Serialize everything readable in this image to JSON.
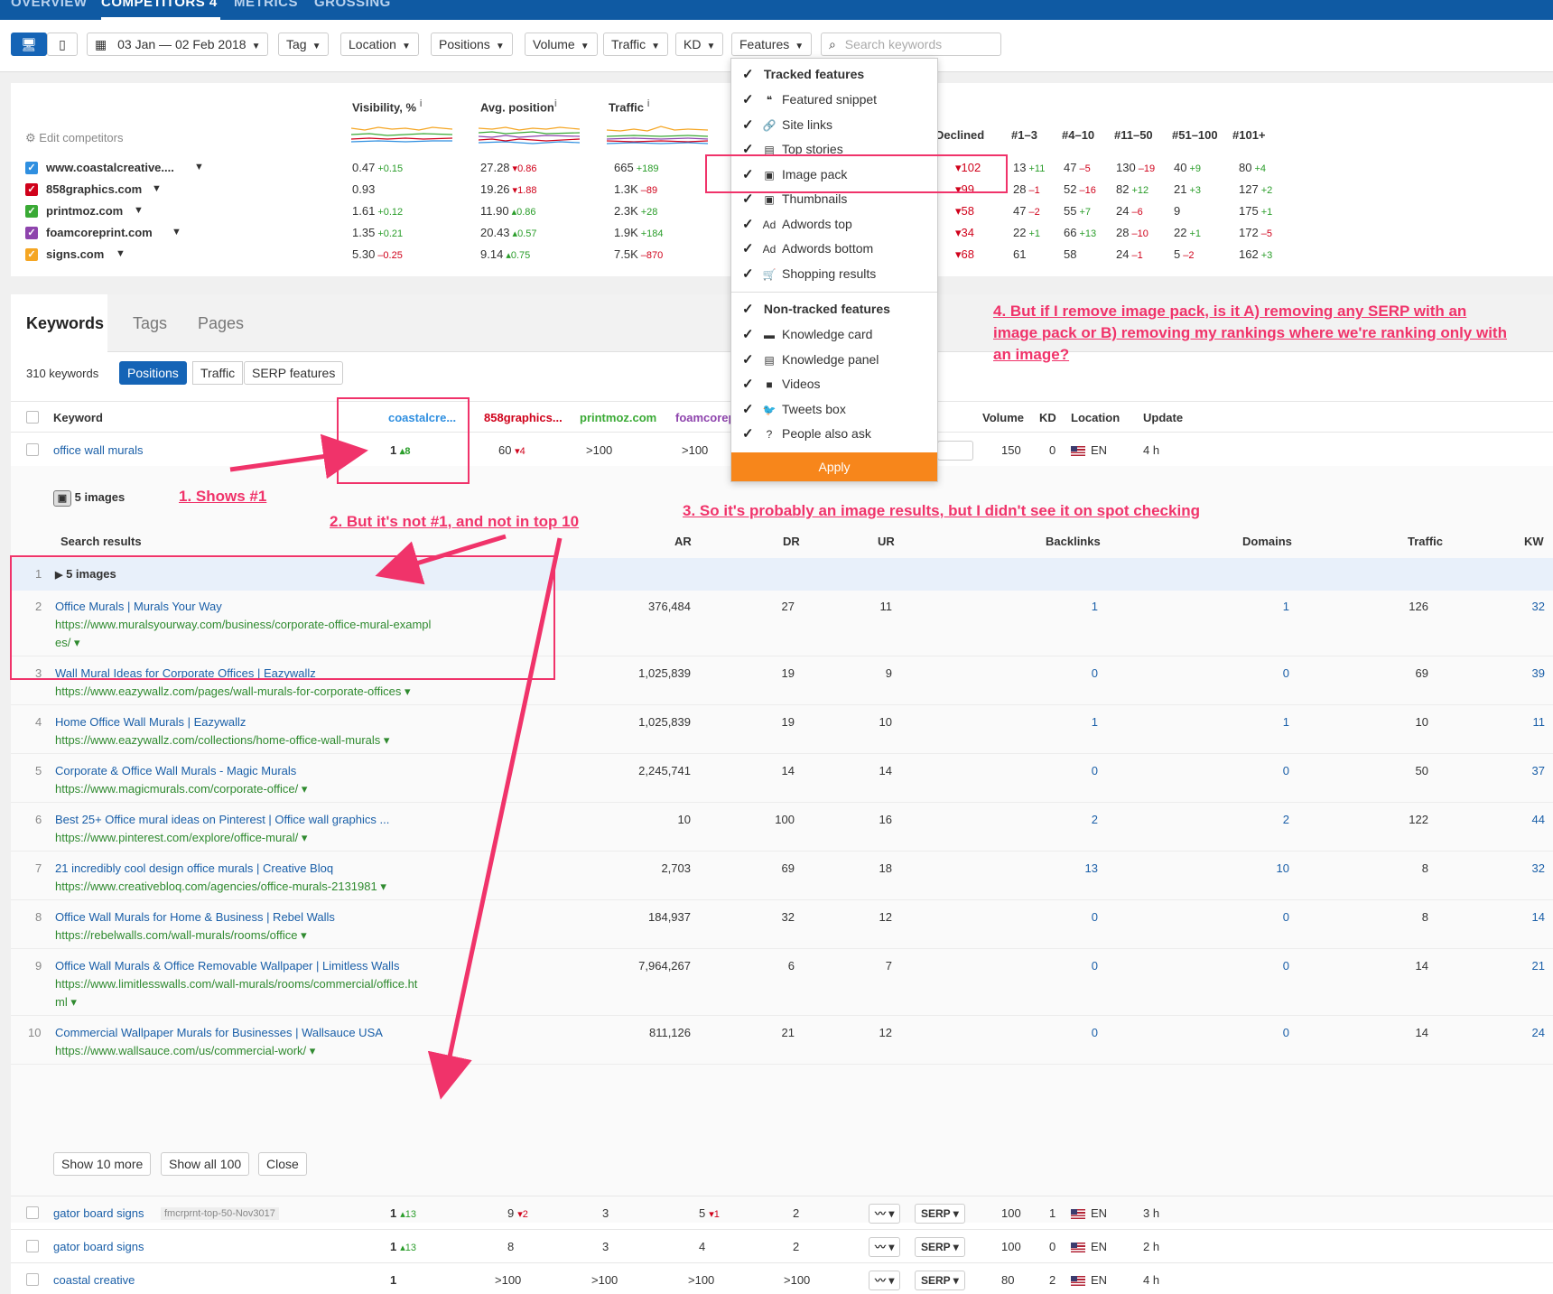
{
  "top_nav": {
    "tabs": [
      "OVERVIEW",
      "COMPETITORS 4",
      "METRICS",
      "GROSSING"
    ]
  },
  "toolbar": {
    "date_range": "03 Jan — 02 Feb 2018",
    "filters": [
      "Tag",
      "Location",
      "Positions",
      "Volume",
      "Traffic",
      "KD",
      "Features"
    ],
    "search_placeholder": "Search keywords"
  },
  "competitors": {
    "edit_label": "Edit competitors",
    "metric_headers": [
      "Visibility, %",
      "Avg. position",
      "Traffic"
    ],
    "rank_headers": [
      "Declined",
      "#1–3",
      "#4–10",
      "#11–50",
      "#51–100",
      "#101+"
    ],
    "rows": [
      {
        "name": "www.coastalcreative....",
        "color": "#2f8fe0",
        "vis": "0.47",
        "vis_d": "+0.15",
        "avg": "27.28",
        "avg_d": "▾0.86",
        "traffic": "665",
        "traffic_d": "+189",
        "declined": "▾102",
        "r1": "13",
        "r1d": "+11",
        "r2": "47",
        "r2d": "–5",
        "r3": "130",
        "r3d": "–19",
        "r4": "40",
        "r4d": "+9",
        "r5": "80",
        "r5d": "+4"
      },
      {
        "name": "858graphics.com",
        "color": "#d0021b",
        "vis": "0.93",
        "vis_d": "",
        "avg": "19.26",
        "avg_d": "▾1.88",
        "traffic": "1.3K",
        "traffic_d": "–89",
        "declined": "▾99",
        "r1": "28",
        "r1d": "–1",
        "r2": "52",
        "r2d": "–16",
        "r3": "82",
        "r3d": "+12",
        "r4": "21",
        "r4d": "+3",
        "r5": "127",
        "r5d": "+2"
      },
      {
        "name": "printmoz.com",
        "color": "#3aaa35",
        "vis": "1.61",
        "vis_d": "+0.12",
        "avg": "11.90",
        "avg_d": "▴0.86",
        "traffic": "2.3K",
        "traffic_d": "+28",
        "declined": "▾58",
        "r1": "47",
        "r1d": "–2",
        "r2": "55",
        "r2d": "+7",
        "r3": "24",
        "r3d": "–6",
        "r4": "9",
        "r4d": "",
        "r5": "175",
        "r5d": "+1"
      },
      {
        "name": "foamcoreprint.com",
        "color": "#8e44ad",
        "vis": "1.35",
        "vis_d": "+0.21",
        "avg": "20.43",
        "avg_d": "▴0.57",
        "traffic": "1.9K",
        "traffic_d": "+184",
        "declined": "▾34",
        "r1": "22",
        "r1d": "+1",
        "r2": "66",
        "r2d": "+13",
        "r3": "28",
        "r3d": "–10",
        "r4": "22",
        "r4d": "+1",
        "r5": "172",
        "r5d": "–5"
      },
      {
        "name": "signs.com",
        "color": "#f5a623",
        "vis": "5.30",
        "vis_d": "–0.25",
        "avg": "9.14",
        "avg_d": "▴0.75",
        "traffic": "7.5K",
        "traffic_d": "–870",
        "declined": "▾68",
        "r1": "61",
        "r1d": "",
        "r2": "58",
        "r2d": "",
        "r3": "24",
        "r3d": "–1",
        "r4": "5",
        "r4d": "–2",
        "r5": "162",
        "r5d": "+3"
      }
    ]
  },
  "keywords": {
    "tabs": [
      "Keywords",
      "Tags",
      "Pages"
    ],
    "count_label": "310 keywords",
    "view_buttons": [
      "Positions",
      "Traffic",
      "SERP features"
    ],
    "columns": [
      "Keyword",
      "coastalcre...",
      "858graphics...",
      "printmoz.com",
      "foamcorep",
      "Volume",
      "KD",
      "Location",
      "Update"
    ],
    "main_row": {
      "keyword": "office wall murals",
      "pos": "1",
      "pos_d": "▴8",
      "c2": "60",
      "c2_d": "▾4",
      "c3": ">100",
      "c4": ">100",
      "serp": "RP ▴",
      "volume": "150",
      "kd": "0",
      "loc": "EN",
      "update": "4 h"
    },
    "images_badge": "5 images"
  },
  "serp": {
    "headers": [
      "Search results",
      "AR",
      "DR",
      "UR",
      "Backlinks",
      "Domains",
      "Traffic",
      "KW"
    ],
    "image_row": {
      "n": "1",
      "label": "5 images"
    },
    "results": [
      {
        "n": "2",
        "title": "Office Murals | Murals Your Way",
        "url": "https://www.muralsyourway.com/business/corporate-office-mural-exampl",
        "url2": "es/ ▾",
        "ar": "376,484",
        "dr": "27",
        "ur": "11",
        "bl": "1",
        "dom": "1",
        "traffic": "126",
        "kw": "32"
      },
      {
        "n": "3",
        "title": "Wall Mural Ideas for Corporate Offices | Eazywallz",
        "url": "https://www.eazywallz.com/pages/wall-murals-for-corporate-offices ▾",
        "url2": "",
        "ar": "1,025,839",
        "dr": "19",
        "ur": "9",
        "bl": "0",
        "dom": "0",
        "traffic": "69",
        "kw": "39"
      },
      {
        "n": "4",
        "title": "Home Office Wall Murals | Eazywallz",
        "url": "https://www.eazywallz.com/collections/home-office-wall-murals ▾",
        "url2": "",
        "ar": "1,025,839",
        "dr": "19",
        "ur": "10",
        "bl": "1",
        "dom": "1",
        "traffic": "10",
        "kw": "11"
      },
      {
        "n": "5",
        "title": "Corporate & Office Wall Murals - Magic Murals",
        "url": "https://www.magicmurals.com/corporate-office/ ▾",
        "url2": "",
        "ar": "2,245,741",
        "dr": "14",
        "ur": "14",
        "bl": "0",
        "dom": "0",
        "traffic": "50",
        "kw": "37"
      },
      {
        "n": "6",
        "title": "Best 25+ Office mural ideas on Pinterest | Office wall graphics ...",
        "url": "https://www.pinterest.com/explore/office-mural/ ▾",
        "url2": "",
        "ar": "10",
        "dr": "100",
        "ur": "16",
        "bl": "2",
        "dom": "2",
        "traffic": "122",
        "kw": "44"
      },
      {
        "n": "7",
        "title": "21 incredibly cool design office murals | Creative Bloq",
        "url": "https://www.creativebloq.com/agencies/office-murals-2131981 ▾",
        "url2": "",
        "ar": "2,703",
        "dr": "69",
        "ur": "18",
        "bl": "13",
        "dom": "10",
        "traffic": "8",
        "kw": "32"
      },
      {
        "n": "8",
        "title": "Office Wall Murals for Home & Business | Rebel Walls",
        "url": "https://rebelwalls.com/wall-murals/rooms/office ▾",
        "url2": "",
        "ar": "184,937",
        "dr": "32",
        "ur": "12",
        "bl": "0",
        "dom": "0",
        "traffic": "8",
        "kw": "14"
      },
      {
        "n": "9",
        "title": "Office Wall Murals & Office Removable Wallpaper | Limitless Walls",
        "url": "https://www.limitlesswalls.com/wall-murals/rooms/commercial/office.ht",
        "url2": "ml ▾",
        "ar": "7,964,267",
        "dr": "6",
        "ur": "7",
        "bl": "0",
        "dom": "0",
        "traffic": "14",
        "kw": "21"
      },
      {
        "n": "10",
        "title": "Commercial Wallpaper Murals for Businesses | Wallsauce USA",
        "url": "https://www.wallsauce.com/us/commercial-work/ ▾",
        "url2": "",
        "ar": "811,126",
        "dr": "21",
        "ur": "12",
        "bl": "0",
        "dom": "0",
        "traffic": "14",
        "kw": "24"
      }
    ],
    "buttons": [
      "Show 10 more",
      "Show all 100",
      "Close"
    ]
  },
  "bottom_rows": [
    {
      "keyword": "gator board signs",
      "tag": "fmcrprnt-top-50-Nov3017",
      "pos": "1",
      "pos_d": "▴13",
      "c2": "9",
      "c2_d": "▾2",
      "c3": "3",
      "c4": "5",
      "c4_d": "▾1",
      "c5": "2",
      "serp": "SERP ▾",
      "volume": "100",
      "kd": "1",
      "loc": "EN",
      "update": "3 h"
    },
    {
      "keyword": "gator board signs",
      "tag": "",
      "pos": "1",
      "pos_d": "▴13",
      "c2": "8",
      "c2_d": "",
      "c3": "3",
      "c4": "4",
      "c4_d": "",
      "c5": "2",
      "serp": "SERP ▾",
      "volume": "100",
      "kd": "0",
      "loc": "EN",
      "update": "2 h"
    },
    {
      "keyword": "coastal creative",
      "tag": "",
      "pos": "1",
      "pos_d": "",
      "c2": ">100",
      "c2_d": "",
      "c3": ">100",
      "c4": ">100",
      "c4_d": "",
      "c5": ">100",
      "serp": "SERP ▾",
      "volume": "80",
      "kd": "2",
      "loc": "EN",
      "update": "4 h"
    }
  ],
  "features_dropdown": {
    "tracked_title": "Tracked features",
    "tracked": [
      "Featured snippet",
      "Site links",
      "Top stories",
      "Image pack",
      "Thumbnails",
      "Adwords top",
      "Adwords bottom",
      "Shopping results"
    ],
    "non_tracked_title": "Non-tracked features",
    "non_tracked": [
      "Knowledge card",
      "Knowledge panel",
      "Videos",
      "Tweets box",
      "People also ask"
    ],
    "apply_label": "Apply"
  },
  "annotations": {
    "a1": "1. Shows #1",
    "a2": "2. But it's not #1, and not in top 10",
    "a3": "3. So it's probably an image results, but I didn't see it on spot checking",
    "a4_line1": "4. But if I remove image pack, is it A) removing any SERP with an",
    "a4_line2": "image pack or B) removing my rankings where we're ranking only with",
    "a4_line3": "an image?"
  },
  "colors": {
    "accent": "#1564b6",
    "annotation": "#f0336a",
    "apply": "#f7861b"
  }
}
